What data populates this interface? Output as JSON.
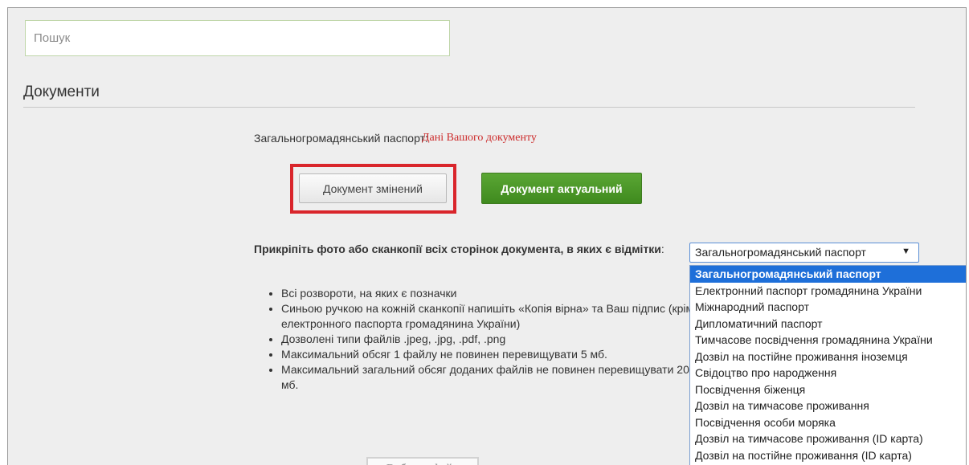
{
  "search": {
    "placeholder": "Пошук"
  },
  "section": {
    "title": "Документи"
  },
  "document": {
    "label": "Загальногромадянський паспорт:",
    "link": "Дані Вашого документу",
    "changed_button": "Документ змінений",
    "actual_button": "Документ актуальний"
  },
  "attach": {
    "heading_bold": "Прикріпіть фото або сканкопії всіх сторінок документа, в яких є відмітки",
    "heading_suffix": ":",
    "rules": [
      "Всі розвороти, на яких є позначки",
      "Синьою ручкою на кожній сканкопії напишіть «Копія вірна» та Ваш підпис (крім електронного паспорта громадянина України)",
      "Дозволені типи файлів .jpeg, .jpg, .pdf, .png",
      "Максимальний обсяг 1 файлу не повинен перевищувати 5 мб.",
      "Максимальний загальний обсяг доданих файлів не повинен перевищувати 20 мб."
    ],
    "file_button": "Вибрати файл"
  },
  "doc_type_select": {
    "selected": "Загальногромадянський паспорт",
    "arrow": "▼",
    "options": [
      "Загальногромадянський паспорт",
      "Електронний паспорт громадянина України",
      "Міжнародний паспорт",
      "Дипломатичний паспорт",
      "Тимчасове посвідчення громадянина України",
      "Дозвіл на постійне проживання іноземця",
      "Свідоцтво про народження",
      "Посвідчення біженця",
      "Дозвіл на тимчасове проживання",
      "Посвідчення особи моряка",
      "Дозвіл на тимчасове проживання (ID карта)",
      "Дозвіл на постійне проживання (ID карта)"
    ]
  },
  "colors": {
    "highlight": "#d9252b",
    "primary_green": "#4a9a28",
    "link_red": "#cc2a2a",
    "option_selected": "#1e6fd9"
  }
}
